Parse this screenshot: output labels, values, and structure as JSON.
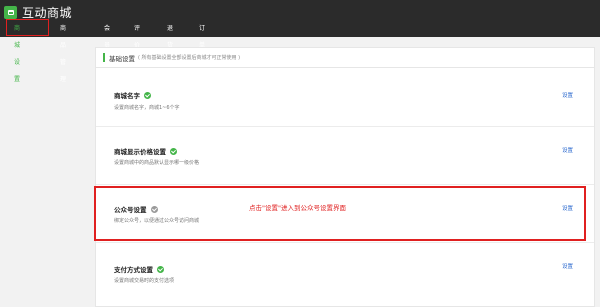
{
  "app": {
    "title": "互动商城"
  },
  "nav": {
    "items": [
      {
        "label": "商城设置",
        "active": true
      },
      {
        "label": "商品管理",
        "active": false
      },
      {
        "label": "会员",
        "active": false
      },
      {
        "label": "评价",
        "active": false
      },
      {
        "label": "退货",
        "active": false
      },
      {
        "label": "订单",
        "active": false
      }
    ]
  },
  "panel": {
    "title": "基础设置",
    "hint": "( 所有基础设置全部设置后商城才可正常使用 )"
  },
  "settings": [
    {
      "title": "商城名字",
      "desc": "设置商城名字，商城1~6个字",
      "link": "设置",
      "status": "done"
    },
    {
      "title": "商城显示价格设置",
      "desc": "设置商城中的商品默认显示哪一级价格",
      "link": "设置",
      "status": "done"
    },
    {
      "title": "公众号设置",
      "desc": "绑定公众号，以便通过公众号访问商城",
      "link": "设置",
      "status": "pending"
    },
    {
      "title": "支付方式设置",
      "desc": "设置商城交易时的支付选项",
      "link": "设置",
      "status": "done"
    }
  ],
  "annotation": "点击\"设置\"进入到公众号设置界面",
  "colors": {
    "accent": "#44b549",
    "link": "#2e6bcf",
    "highlight": "#e02020",
    "topbar": "#2b2b2b"
  }
}
